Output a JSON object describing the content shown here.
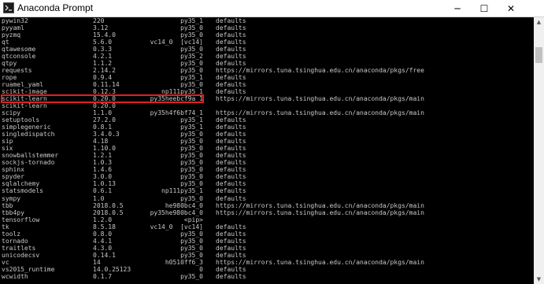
{
  "window": {
    "title": "Anaconda Prompt",
    "icon": "terminal-icon",
    "minimize_glyph": "─",
    "maximize_glyph": "☐",
    "close_glyph": "✕"
  },
  "scrollbar": {
    "up_glyph": "▲",
    "down_glyph": "▼"
  },
  "colors": {
    "console_bg": "#000000",
    "console_text": "#c8c8c8",
    "highlight": "#e02020"
  },
  "rows": [
    {
      "name": "pywin32",
      "version": "220",
      "build": "py35_1",
      "channel": "defaults"
    },
    {
      "name": "pyyaml",
      "version": "3.12",
      "build": "py35_0",
      "channel": "defaults"
    },
    {
      "name": "pyzmq",
      "version": "15.4.0",
      "build": "py35_0",
      "channel": "defaults"
    },
    {
      "name": "qt",
      "version": "5.6.0",
      "build": "vc14_0  [vc14]",
      "channel": "defaults"
    },
    {
      "name": "qtawesome",
      "version": "0.3.3",
      "build": "py35_0",
      "channel": "defaults"
    },
    {
      "name": "qtconsole",
      "version": "4.2.1",
      "build": "py35_2",
      "channel": "defaults"
    },
    {
      "name": "qtpy",
      "version": "1.1.2",
      "build": "py35_0",
      "channel": "defaults"
    },
    {
      "name": "requests",
      "version": "2.14.2",
      "build": "py35_0",
      "channel": "https://mirrors.tuna.tsinghua.edu.cn/anaconda/pkgs/free"
    },
    {
      "name": "rope",
      "version": "0.9.4",
      "build": "py35_1",
      "channel": "defaults"
    },
    {
      "name": "ruamel_yaml",
      "version": "0.11.14",
      "build": "py35_0",
      "channel": "defaults"
    },
    {
      "name": "scikit-image",
      "version": "0.12.3",
      "build": "np111py35_1",
      "channel": "defaults"
    },
    {
      "name": "scikit-learn",
      "version": "0.20.0",
      "build": "py35heebcf9a_1",
      "channel": "https://mirrors.tuna.tsinghua.edu.cn/anaconda/pkgs/main"
    },
    {
      "name": "scikit-learn",
      "version": "0.20.0",
      "build": "",
      "channel": ""
    },
    {
      "name": "scipy",
      "version": "1.1.0",
      "build": "py35h4f6bf74_1",
      "channel": "https://mirrors.tuna.tsinghua.edu.cn/anaconda/pkgs/main"
    },
    {
      "name": "setuptools",
      "version": "27.2.0",
      "build": "py35_1",
      "channel": "defaults"
    },
    {
      "name": "simplegeneric",
      "version": "0.8.1",
      "build": "py35_1",
      "channel": "defaults"
    },
    {
      "name": "singledispatch",
      "version": "3.4.0.3",
      "build": "py35_0",
      "channel": "defaults"
    },
    {
      "name": "sip",
      "version": "4.18",
      "build": "py35_0",
      "channel": "defaults"
    },
    {
      "name": "six",
      "version": "1.10.0",
      "build": "py35_0",
      "channel": "defaults"
    },
    {
      "name": "snowballstemmer",
      "version": "1.2.1",
      "build": "py35_0",
      "channel": "defaults"
    },
    {
      "name": "sockjs-tornado",
      "version": "1.0.3",
      "build": "py35_0",
      "channel": "defaults"
    },
    {
      "name": "sphinx",
      "version": "1.4.6",
      "build": "py35_0",
      "channel": "defaults"
    },
    {
      "name": "spyder",
      "version": "3.0.0",
      "build": "py35_0",
      "channel": "defaults"
    },
    {
      "name": "sqlalchemy",
      "version": "1.0.13",
      "build": "py35_0",
      "channel": "defaults"
    },
    {
      "name": "statsmodels",
      "version": "0.6.1",
      "build": "np111py35_1",
      "channel": "defaults"
    },
    {
      "name": "sympy",
      "version": "1.0",
      "build": "py35_0",
      "channel": "defaults"
    },
    {
      "name": "tbb",
      "version": "2018.0.5",
      "build": "he980bc4_0",
      "channel": "https://mirrors.tuna.tsinghua.edu.cn/anaconda/pkgs/main"
    },
    {
      "name": "tbb4py",
      "version": "2018.0.5",
      "build": "py35he980bc4_0",
      "channel": "https://mirrors.tuna.tsinghua.edu.cn/anaconda/pkgs/main"
    },
    {
      "name": "tensorflow",
      "version": "1.2.0",
      "build": "<pip>",
      "channel": ""
    },
    {
      "name": "tk",
      "version": "8.5.18",
      "build": "vc14_0  [vc14]",
      "channel": "defaults"
    },
    {
      "name": "toolz",
      "version": "0.8.0",
      "build": "py35_0",
      "channel": "defaults"
    },
    {
      "name": "tornado",
      "version": "4.4.1",
      "build": "py35_0",
      "channel": "defaults"
    },
    {
      "name": "traitlets",
      "version": "4.3.0",
      "build": "py35_0",
      "channel": "defaults"
    },
    {
      "name": "unicodecsv",
      "version": "0.14.1",
      "build": "py35_0",
      "channel": "defaults"
    },
    {
      "name": "vc",
      "version": "14",
      "build": "h0510ff6_3",
      "channel": "https://mirrors.tuna.tsinghua.edu.cn/anaconda/pkgs/main"
    },
    {
      "name": "vs2015_runtime",
      "version": "14.0.25123",
      "build": "0",
      "channel": "defaults"
    },
    {
      "name": "wcwidth",
      "version": "0.1.7",
      "build": "py35_0",
      "channel": "defaults"
    }
  ]
}
